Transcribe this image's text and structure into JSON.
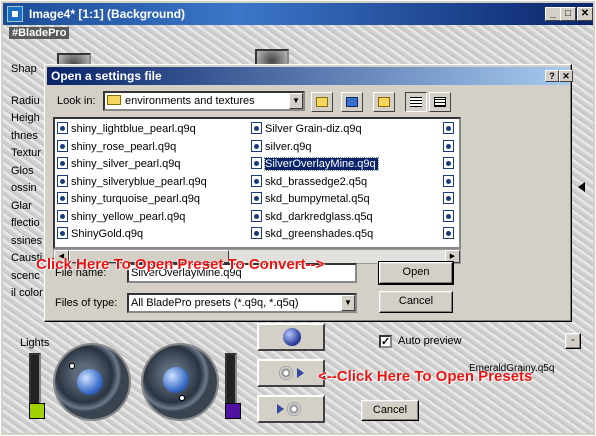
{
  "outer": {
    "title": "Image4* [1:1] (Background)",
    "plugin_label": "#BladePro",
    "side_labels": [
      "Shap",
      "Radiu",
      "Heigh",
      "thnes",
      "Textur",
      "Glos",
      "ossin",
      "Glar",
      "flectio",
      "ssines",
      "Causti",
      "scenc",
      "il color"
    ],
    "lights_label": "Lights",
    "auto_preview_label": "Auto preview",
    "auto_preview_checked": "✓",
    "preset_name": "EmeraldGrainy.q5q",
    "cancel_label": "Cancel",
    "title_buttons": {
      "minimize": "_",
      "maximize": "□",
      "close": "✕"
    },
    "colors": {
      "swatch_left": "#a0d000",
      "swatch_right": "#5010a0"
    }
  },
  "dialog": {
    "title": "Open a settings file",
    "help_btn": "?",
    "close_btn": "✕",
    "look_in_label": "Look in:",
    "look_in_value": "environments and textures",
    "files_col1": [
      "shiny_lightblue_pearl.q9q",
      "shiny_rose_pearl.q9q",
      "shiny_silver_pearl.q9q",
      "shiny_silveryblue_pearl.q9q",
      "shiny_turquoise_pearl.q9q",
      "shiny_yellow_pearl.q9q",
      "ShinyGold.q9q"
    ],
    "files_col2": [
      "Silver Grain-diz.q9q",
      "silver.q9q",
      "SilverOverlayMine.q9q",
      "skd_brassedge2.q5q",
      "skd_bumpymetal.q5q",
      "skd_darkredglass.q5q",
      "skd_greenshades.q5q"
    ],
    "selected_file": "SilverOverlayMine.q9q",
    "file_name_label": "File name:",
    "file_name_value": "SilverOverlayMine.q9q",
    "files_of_type_label": "Files of type:",
    "files_of_type_value": "All BladePro presets (*.q9q, *.q5q)",
    "open_label": "Open",
    "cancel_label": "Cancel"
  },
  "annotations": {
    "convert": "Click Here To Open Preset To Convert-->",
    "presets": "<--Click Here To Open Presets"
  }
}
